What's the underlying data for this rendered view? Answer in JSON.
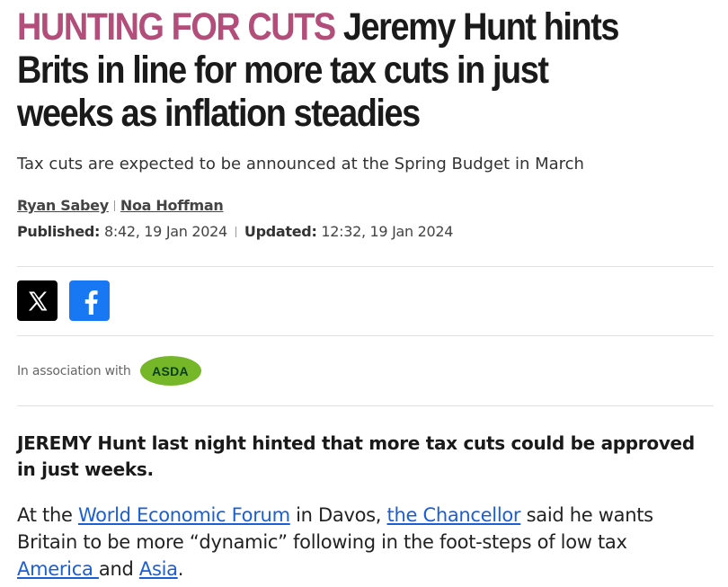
{
  "article": {
    "kicker": "HUNTING FOR CUTS",
    "headline": "Jeremy Hunt hints Brits in line for more tax cuts in just weeks as inflation steadies",
    "standfirst": "Tax cuts are expected to be announced at the Spring Budget in March",
    "authors": [
      "Ryan Sabey",
      "Noa Hoffman"
    ],
    "published_label": "Published:",
    "published_value": "8:42, 19 Jan 2024",
    "updated_label": "Updated:",
    "updated_value": "12:32, 19 Jan 2024"
  },
  "share": {
    "icons": [
      "x-logo-icon",
      "facebook-logo-icon"
    ]
  },
  "association": {
    "label": "In association with",
    "partner": "ASDA"
  },
  "body": {
    "lead": "JEREMY Hunt last night hinted that more tax cuts could be approved in just weeks.",
    "p1_t1": "At the ",
    "p1_link1": "World Economic Forum",
    "p1_t2": " in Davos, ",
    "p1_link2": "the Chancellor",
    "p1_t3": " said he wants Britain to be more “dynamic” following in the foot-steps of low tax ",
    "p1_link3": "America ",
    "p1_t4": "and ",
    "p1_link4": "Asia",
    "p1_t5": "."
  },
  "colors": {
    "kicker": "#b34d7a",
    "link": "#1a5fd6",
    "facebook": "#1877f2",
    "asda_green": "#76b72a"
  }
}
